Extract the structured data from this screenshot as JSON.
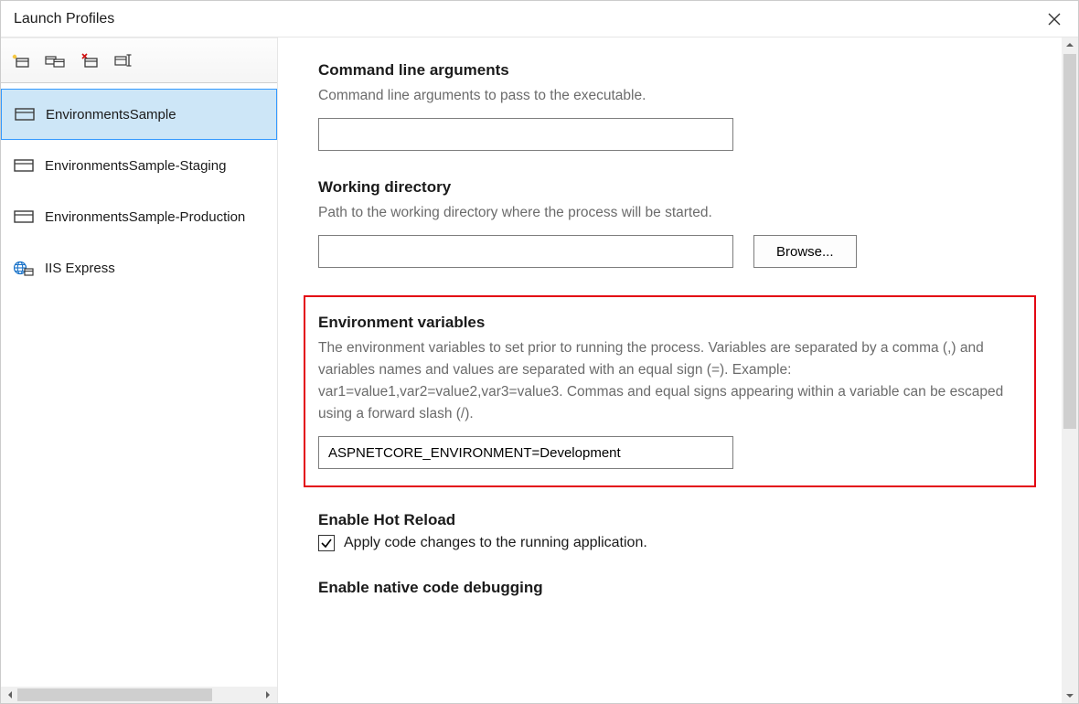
{
  "window": {
    "title": "Launch Profiles"
  },
  "toolbar": {
    "items": [
      {
        "name": "new-launch-profile-icon"
      },
      {
        "name": "duplicate-launch-profile-icon"
      },
      {
        "name": "delete-launch-profile-icon"
      },
      {
        "name": "rename-launch-profile-icon"
      }
    ]
  },
  "profiles": [
    {
      "label": "EnvironmentsSample",
      "icon": "project",
      "selected": true
    },
    {
      "label": "EnvironmentsSample-Staging",
      "icon": "project",
      "selected": false
    },
    {
      "label": "EnvironmentsSample-Production",
      "icon": "project",
      "selected": false
    },
    {
      "label": "IIS Express",
      "icon": "iis",
      "selected": false
    }
  ],
  "sections": {
    "cmdline": {
      "title": "Command line arguments",
      "desc": "Command line arguments to pass to the executable.",
      "value": ""
    },
    "workdir": {
      "title": "Working directory",
      "desc": "Path to the working directory where the process will be started.",
      "value": "",
      "browse_label": "Browse..."
    },
    "envvars": {
      "title": "Environment variables",
      "desc": "The environment variables to set prior to running the process. Variables are separated by a comma (,) and variables names and values are separated with an equal sign (=). Example: var1=value1,var2=value2,var3=value3. Commas and equal signs appearing within a variable can be escaped using a forward slash (/).",
      "value": "ASPNETCORE_ENVIRONMENT=Development"
    },
    "hotreload": {
      "title": "Enable Hot Reload",
      "checkbox_label": "Apply code changes to the running application.",
      "checked": true
    },
    "native": {
      "title": "Enable native code debugging"
    }
  }
}
